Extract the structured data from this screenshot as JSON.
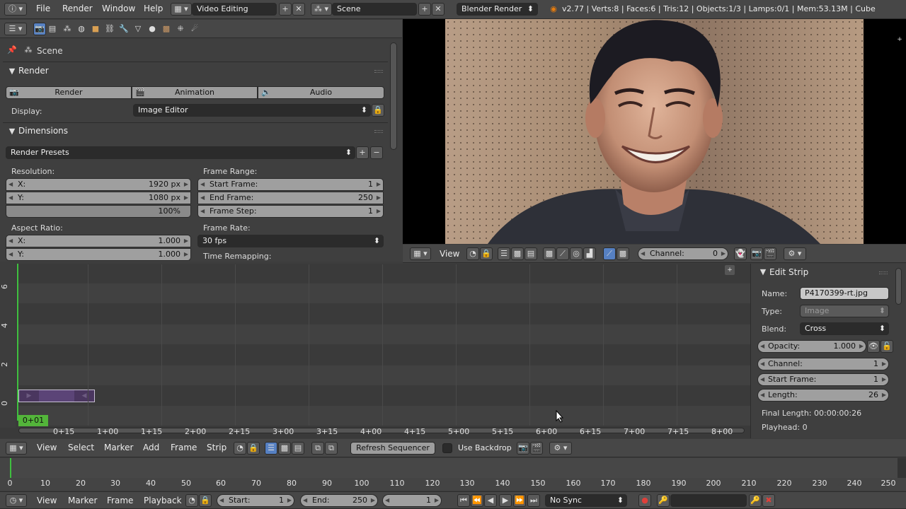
{
  "top_bar": {
    "menus": [
      "File",
      "Render",
      "Window",
      "Help"
    ],
    "screen_layout": "Video Editing",
    "scene": "Scene",
    "engine": "Blender Render",
    "stats": "v2.77 | Verts:8 | Faces:6 | Tris:12 | Objects:1/3 | Lamps:0/1 | Mem:53.13M | Cube"
  },
  "properties": {
    "breadcrumb": "Scene",
    "render_panel": {
      "title": "Render",
      "buttons": [
        "Render",
        "Animation",
        "Audio"
      ],
      "display_label": "Display:",
      "display_value": "Image Editor"
    },
    "dimensions_panel": {
      "title": "Dimensions",
      "presets": "Render Presets",
      "resolution_label": "Resolution:",
      "res_x_label": "X:",
      "res_x": "1920 px",
      "res_y_label": "Y:",
      "res_y": "1080 px",
      "res_pct": "100%",
      "aspect_label": "Aspect Ratio:",
      "asp_x_label": "X:",
      "asp_x": "1.000",
      "asp_y_label": "Y:",
      "asp_y": "1.000",
      "frame_range_label": "Frame Range:",
      "start_label": "Start Frame:",
      "start": "1",
      "end_label": "End Frame:",
      "end": "250",
      "step_label": "Frame Step:",
      "step": "1",
      "frame_rate_label": "Frame Rate:",
      "fps": "30 fps",
      "time_remap_label": "Time Remapping:"
    }
  },
  "preview_header": {
    "view": "View",
    "channel_label": "Channel:",
    "channel": "0"
  },
  "sequencer": {
    "channel_labels": [
      "6",
      "4",
      "2",
      "0"
    ],
    "current_frame": "0+01",
    "time_ticks": [
      "0+15",
      "1+00",
      "1+15",
      "2+00",
      "2+15",
      "3+00",
      "3+15",
      "4+00",
      "4+15",
      "5+00",
      "5+15",
      "6+00",
      "6+15",
      "7+00",
      "7+15",
      "8+00"
    ],
    "strip_color": "#5b4477"
  },
  "edit_strip": {
    "title": "Edit Strip",
    "name_label": "Name:",
    "name": "P4170399-rt.jpg",
    "type_label": "Type:",
    "type": "Image",
    "blend_label": "Blend:",
    "blend": "Cross",
    "opacity_label": "Opacity:",
    "opacity": "1.000",
    "channel_label": "Channel:",
    "channel": "1",
    "start_label": "Start Frame:",
    "start": "1",
    "length_label": "Length:",
    "length": "26",
    "final_length": "Final Length: 00:00:00:26",
    "playhead": "Playhead: 0"
  },
  "sequencer_header": {
    "menus": [
      "View",
      "Select",
      "Marker",
      "Add",
      "Frame",
      "Strip"
    ],
    "refresh": "Refresh Sequencer",
    "use_backdrop": "Use Backdrop"
  },
  "timeline": {
    "ticks": [
      "0",
      "10",
      "20",
      "30",
      "40",
      "50",
      "60",
      "70",
      "80",
      "90",
      "100",
      "110",
      "120",
      "130",
      "140",
      "150",
      "160",
      "170",
      "180",
      "190",
      "200",
      "210",
      "220",
      "230",
      "240",
      "250"
    ]
  },
  "timeline_header": {
    "menus": [
      "View",
      "Marker",
      "Frame",
      "Playback"
    ],
    "start_label": "Start:",
    "start": "1",
    "end_label": "End:",
    "end": "250",
    "current": "1",
    "sync": "No Sync"
  }
}
